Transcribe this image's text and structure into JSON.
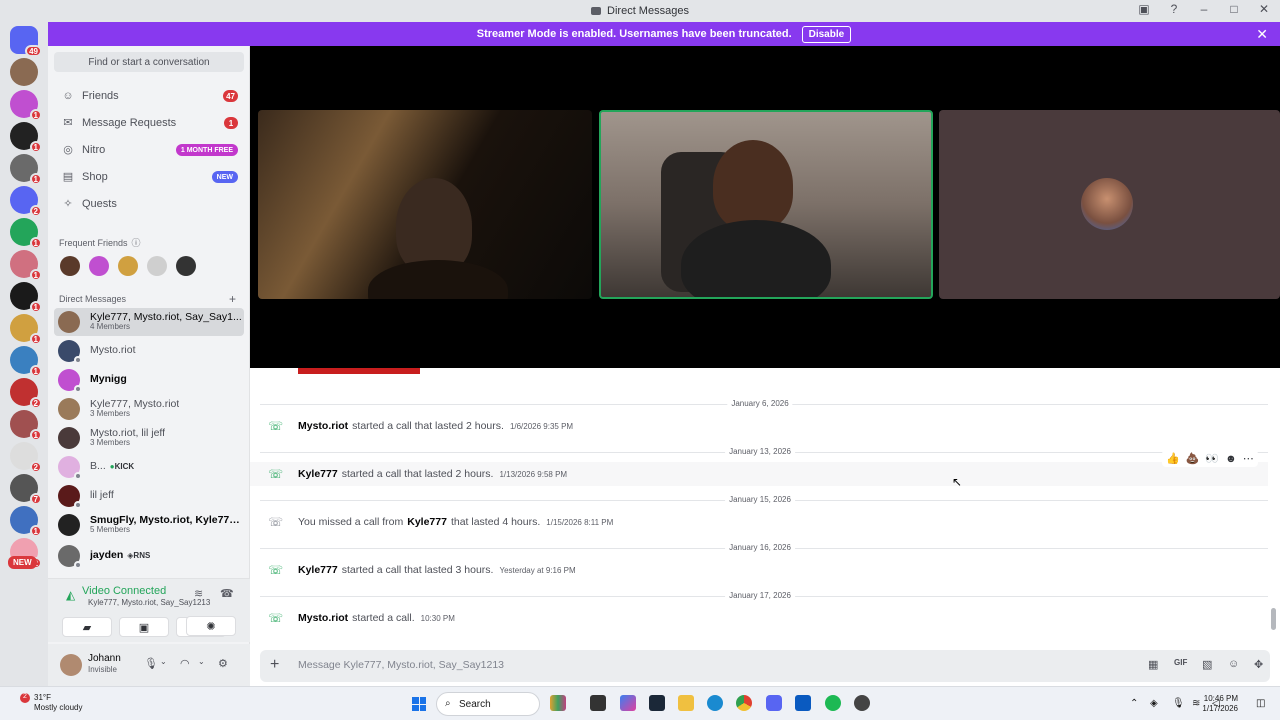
{
  "window": {
    "title": "Direct Messages"
  },
  "banner": {
    "text": "Streamer Mode is enabled. Usernames have been truncated.",
    "button": "Disable"
  },
  "servers": {
    "home_badge": "49",
    "badges": [
      "1",
      "1",
      "1",
      "2",
      "1",
      "1",
      "1",
      "1",
      "1",
      "2",
      "1",
      "2",
      "7",
      "1",
      "2"
    ],
    "new_label": "NEW"
  },
  "sidebar": {
    "search_placeholder": "Find or start a conversation",
    "nav": [
      {
        "label": "Friends",
        "badge": "47"
      },
      {
        "label": "Message Requests",
        "badge": "1"
      },
      {
        "label": "Nitro",
        "badge": "1 MONTH FREE"
      },
      {
        "label": "Shop",
        "badge": "NEW"
      },
      {
        "label": "Quests",
        "badge": ""
      }
    ],
    "frequent_friends_label": "Frequent Friends",
    "direct_messages_label": "Direct Messages",
    "dms": [
      {
        "name": "Kyle777, Mysto.riot, Say_Say1...",
        "sub": "4 Members"
      },
      {
        "name": "Mysto.riot",
        "sub": ""
      },
      {
        "name": "Mynigg",
        "sub": ""
      },
      {
        "name": "Kyle777, Mysto.riot",
        "sub": "3 Members"
      },
      {
        "name": "Mysto.riot, lil jeff",
        "sub": "3 Members"
      },
      {
        "name": "B...",
        "sub": "",
        "tag": "KICK"
      },
      {
        "name": "lil jeff",
        "sub": ""
      },
      {
        "name": "SmugFly, Mysto.riot, Kyle777,...",
        "sub": "5 Members"
      },
      {
        "name": "jayden",
        "sub": "",
        "tag": "RNS"
      }
    ]
  },
  "voice": {
    "status": "Video Connected",
    "channel": "Kyle777, Mysto.riot, Say_Say1213"
  },
  "user": {
    "name": "Johann",
    "status": "Invisible"
  },
  "chat": {
    "entries": [
      {
        "date": "January 6, 2026",
        "name": "Mysto.riot",
        "text": "started a call that lasted 2 hours.",
        "time": "1/6/2026 9:35 PM"
      },
      {
        "date": "January 13, 2026",
        "name": "Kyle777",
        "text": "started a call that lasted 2 hours.",
        "time": "1/13/2026 9:58 PM"
      },
      {
        "date": "January 15, 2026",
        "prefix": "You missed a call from",
        "name": "Kyle777",
        "text": "that lasted 4 hours.",
        "time": "1/15/2026 8:11 PM"
      },
      {
        "date": "January 16, 2026",
        "name": "Kyle777",
        "text": "started a call that lasted 3 hours.",
        "time": "Yesterday at 9:16 PM"
      },
      {
        "date": "January 17, 2026",
        "name": "Mysto.riot",
        "text": "started a call.",
        "time": "10:30 PM"
      }
    ],
    "input_placeholder": "Message Kyle777, Mysto.riot, Say_Say1213"
  },
  "taskbar": {
    "weather_temp": "31°F",
    "weather_desc": "Mostly cloudy",
    "weather_badge": "2",
    "search_label": "Search",
    "time": "10:46 PM",
    "date": "1/17/2026"
  }
}
